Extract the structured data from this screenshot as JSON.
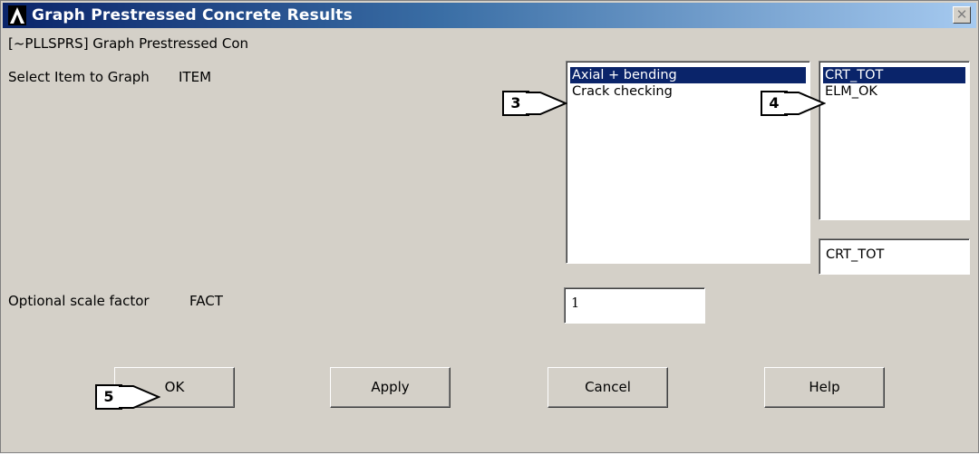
{
  "window": {
    "title": "Graph Prestressed Concrete Results",
    "close_glyph": "✕"
  },
  "command_label": "[~PLLSPRS] Graph Prestressed Con",
  "item": {
    "label": "Select Item to Graph",
    "param": "ITEM",
    "categories": [
      "Axial + bending",
      "Crack checking"
    ],
    "selected_category": "Axial + bending",
    "components": [
      "CRT_TOT",
      "ELM_OK"
    ],
    "selected_component": "CRT_TOT",
    "component_value": "CRT_TOT"
  },
  "fact": {
    "label": "Optional scale factor",
    "param": "FACT",
    "value": "1"
  },
  "buttons": {
    "ok": "OK",
    "apply": "Apply",
    "cancel": "Cancel",
    "help": "Help"
  },
  "callouts": {
    "c3": "3",
    "c4": "4",
    "c5": "5"
  },
  "colors": {
    "title_gradient_start": "#0a246a",
    "title_gradient_end": "#a6caf0",
    "selection": "#0a246a",
    "dialog_bg": "#d4d0c8"
  }
}
